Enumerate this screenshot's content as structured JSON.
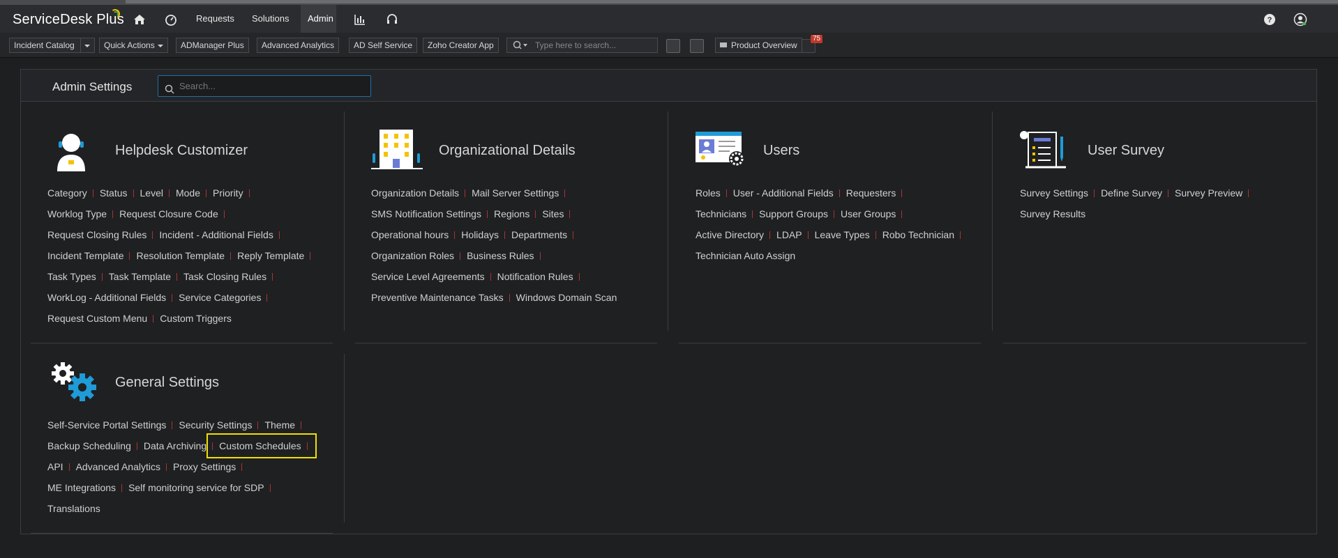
{
  "app": {
    "name_main": "ServiceDesk",
    "name_plus": "Plus"
  },
  "nav": {
    "home_icon": "home-icon",
    "dashboard_icon": "speedometer-icon",
    "items": [
      {
        "label": "Requests"
      },
      {
        "label": "Solutions"
      },
      {
        "label": "Admin"
      }
    ],
    "reports_icon": "bar-chart-icon",
    "support_icon": "headset-icon",
    "help_icon": "help-icon",
    "user_icon": "user-icon"
  },
  "toolbar": {
    "incident_catalog": "Incident Catalog",
    "quick_actions": "Quick Actions",
    "admanager": "ADManager Plus",
    "advanced_analytics": "Advanced Analytics",
    "ad_self_service": "AD Self Service",
    "zoho_creator": "Zoho Creator App",
    "search_placeholder": "Type here to search...",
    "product_overview": "Product Overview",
    "badge_count": "75"
  },
  "admin": {
    "title": "Admin Settings",
    "search_placeholder": "Search..."
  },
  "sections": {
    "helpdesk": {
      "title": "Helpdesk Customizer",
      "lines": [
        [
          "Category",
          "Status",
          "Level",
          "Mode",
          "Priority"
        ],
        [
          "Worklog Type",
          "Request Closure Code"
        ],
        [
          "Request Closing Rules",
          "Incident - Additional Fields"
        ],
        [
          "Incident Template",
          "Resolution Template",
          "Reply Template"
        ],
        [
          "Task Types",
          "Task Template",
          "Task Closing Rules"
        ],
        [
          "WorkLog - Additional Fields",
          "Service Categories"
        ],
        [
          "Request Custom Menu",
          "Custom Triggers"
        ]
      ]
    },
    "org": {
      "title": "Organizational Details",
      "lines": [
        [
          "Organization Details",
          "Mail Server Settings"
        ],
        [
          "SMS Notification Settings",
          "Regions",
          "Sites"
        ],
        [
          "Operational hours",
          "Holidays",
          "Departments"
        ],
        [
          "Organization Roles",
          "Business Rules"
        ],
        [
          "Service Level Agreements",
          "Notification Rules"
        ],
        [
          "Preventive Maintenance Tasks",
          "Windows Domain Scan"
        ]
      ]
    },
    "users": {
      "title": "Users",
      "lines": [
        [
          "Roles",
          "User - Additional Fields",
          "Requesters"
        ],
        [
          "Technicians",
          "Support Groups",
          "User Groups"
        ],
        [
          "Active Directory",
          "LDAP",
          "Leave Types",
          "Robo Technician"
        ],
        [
          "Technician Auto Assign"
        ]
      ]
    },
    "survey": {
      "title": "User Survey",
      "lines": [
        [
          "Survey Settings",
          "Define Survey",
          "Survey Preview"
        ],
        [
          "Survey Results"
        ]
      ]
    },
    "general": {
      "title": "General Settings",
      "lines": [
        [
          "Self-Service Portal Settings",
          "Security Settings",
          "Theme"
        ],
        [
          "Backup Scheduling",
          "Data Archiving",
          "Custom Schedules"
        ],
        [
          "API",
          "Advanced Analytics",
          "Proxy Settings"
        ],
        [
          "ME Integrations",
          "Self monitoring service for SDP"
        ],
        [
          "Translations"
        ]
      ]
    }
  }
}
